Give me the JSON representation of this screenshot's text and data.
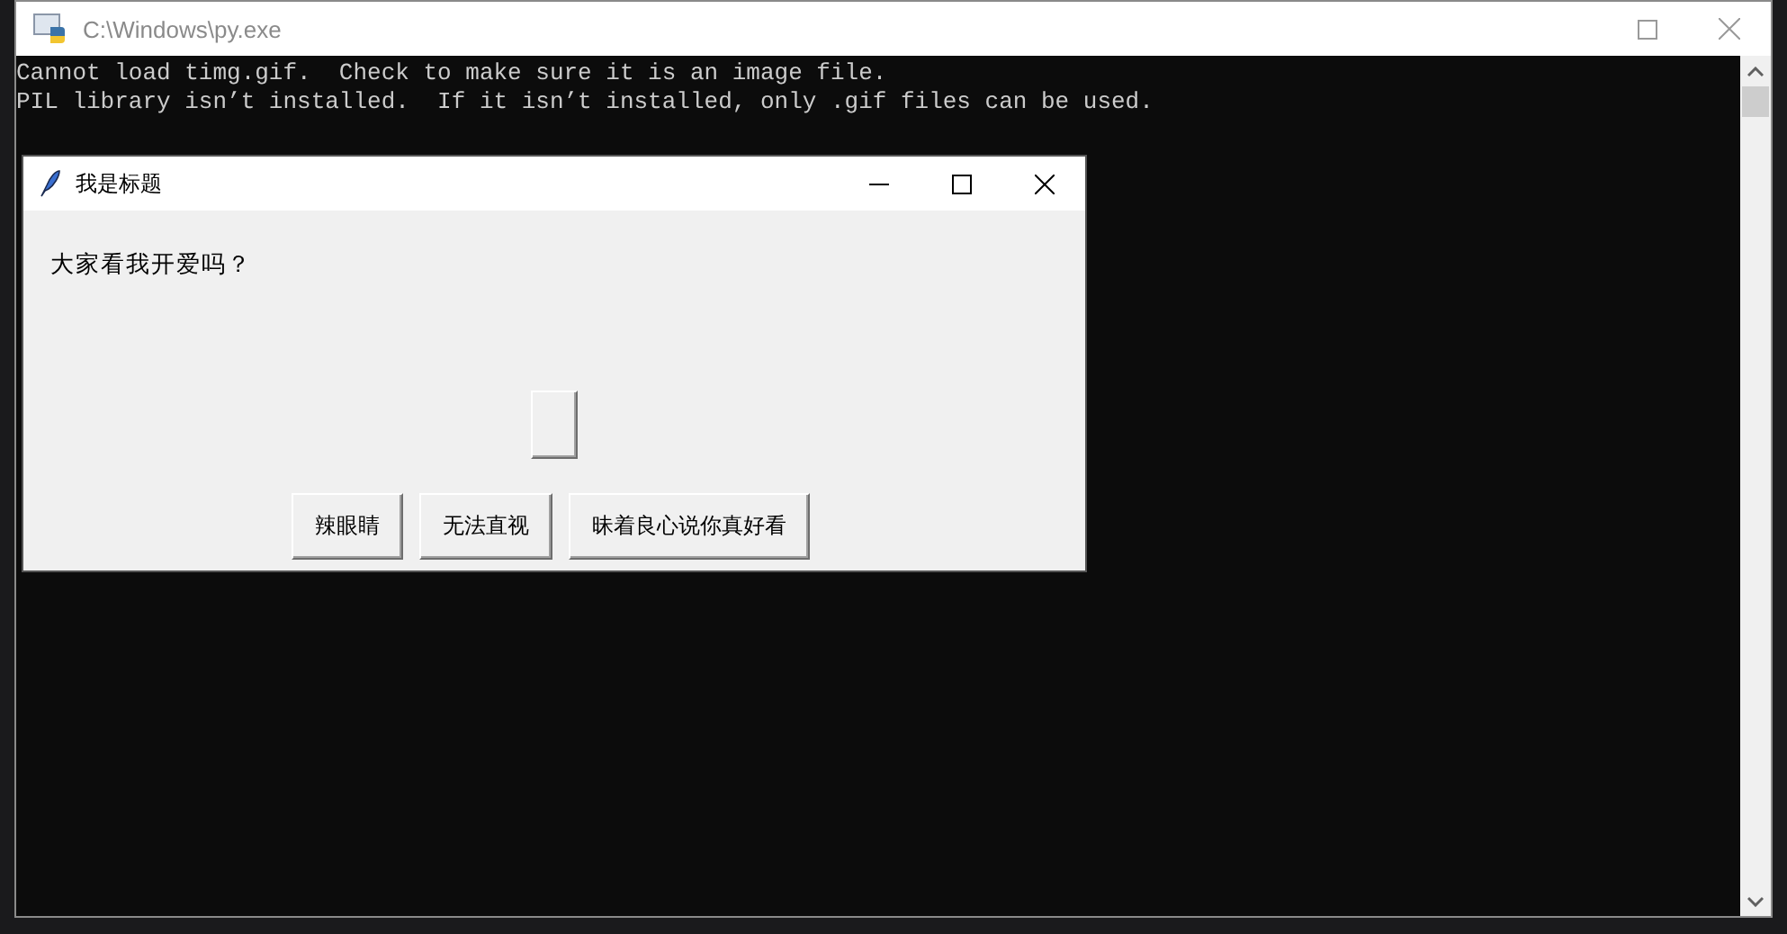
{
  "console_window": {
    "title": "C:\\Windows\\py.exe",
    "output_lines": [
      "Cannot load timg.gif.  Check to make sure it is an image file.",
      "PIL library isn’t installed.  If it isn’t installed, only .gif files can be used."
    ]
  },
  "dialog": {
    "title": "我是标题",
    "message": "大家看我开爱吗？",
    "buttons": [
      "辣眼睛",
      "无法直视",
      "昧着良心说你真好看"
    ]
  }
}
